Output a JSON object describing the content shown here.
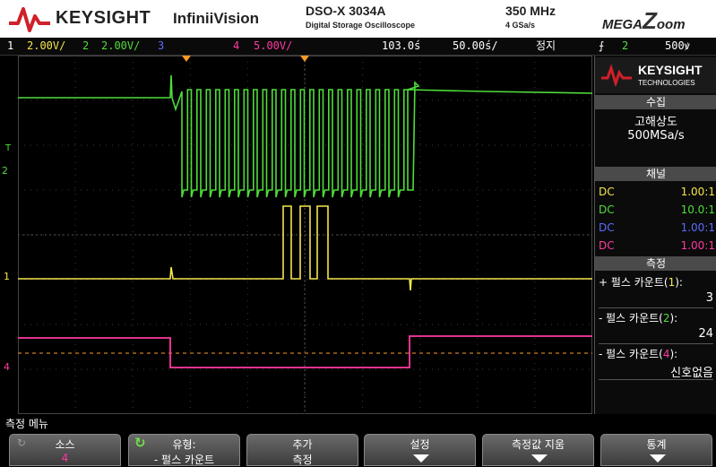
{
  "banner": {
    "brand": "KEYSIGHT",
    "product": "InfiniiVision",
    "model": "DSO-X 3034A",
    "model_sub": "Digital Storage Oscilloscope",
    "bandwidth": "350 MHz",
    "sample_rate": "4 GSa/s",
    "mega": "MEGA",
    "zoom_z": "Z",
    "zoom_rest": "oom"
  },
  "status": {
    "ch1_num": "1",
    "ch1_scale": "2.00V/",
    "ch2_num": "2",
    "ch2_scale": "2.00V/",
    "ch3_num": "3",
    "ch4_num": "4",
    "ch4_scale": "5.00V/",
    "time_pos": "103.0ś",
    "time_scale": "50.00ś/",
    "run_state": "정지",
    "trig_src": "2",
    "trig_level": "500ꝟ"
  },
  "panel": {
    "ks_line1": "KEYSIGHT",
    "ks_line2": "TECHNOLOGIES",
    "acq_header": "수집",
    "acq_mode": "고해상도",
    "acq_rate": "500MSa/s",
    "ch_header": "채널",
    "channels": [
      {
        "coupling": "DC",
        "probe": "1.00:1"
      },
      {
        "coupling": "DC",
        "probe": "10.0:1"
      },
      {
        "coupling": "DC",
        "probe": "1.00:1"
      },
      {
        "coupling": "DC",
        "probe": "1.00:1"
      }
    ],
    "meas_header": "측정",
    "meas": [
      {
        "prefix": "+ 펄스 카운트(",
        "ch": "1",
        "suffix": "):",
        "value": "3"
      },
      {
        "prefix": "- 펄스 카운트(",
        "ch": "2",
        "suffix": "):",
        "value": "24"
      },
      {
        "prefix": "- 펄스 카운트(",
        "ch": "4",
        "suffix": "):",
        "value": "신호없음"
      }
    ]
  },
  "menu": {
    "title": "측정 메뉴",
    "keys": [
      {
        "line1": "소스",
        "line2": "4"
      },
      {
        "line1": "유형:",
        "line2": "- 펄스 카운트"
      },
      {
        "line1": "추가",
        "line2": "측정"
      },
      {
        "line1": "설정",
        "line2": ""
      },
      {
        "line1": "측정값 지움",
        "line2": ""
      },
      {
        "line1": "통계",
        "line2": ""
      }
    ]
  },
  "colors": {
    "ch1": "#f4e64a",
    "ch2": "#4fdc3a",
    "ch3": "#5a6bff",
    "ch4": "#ff3aa0",
    "trigger": "#ff9a2a"
  },
  "markers": {
    "ch2_marker": "2",
    "ch1_marker": "1",
    "ch4_marker": "4",
    "trig_marker": "T"
  }
}
